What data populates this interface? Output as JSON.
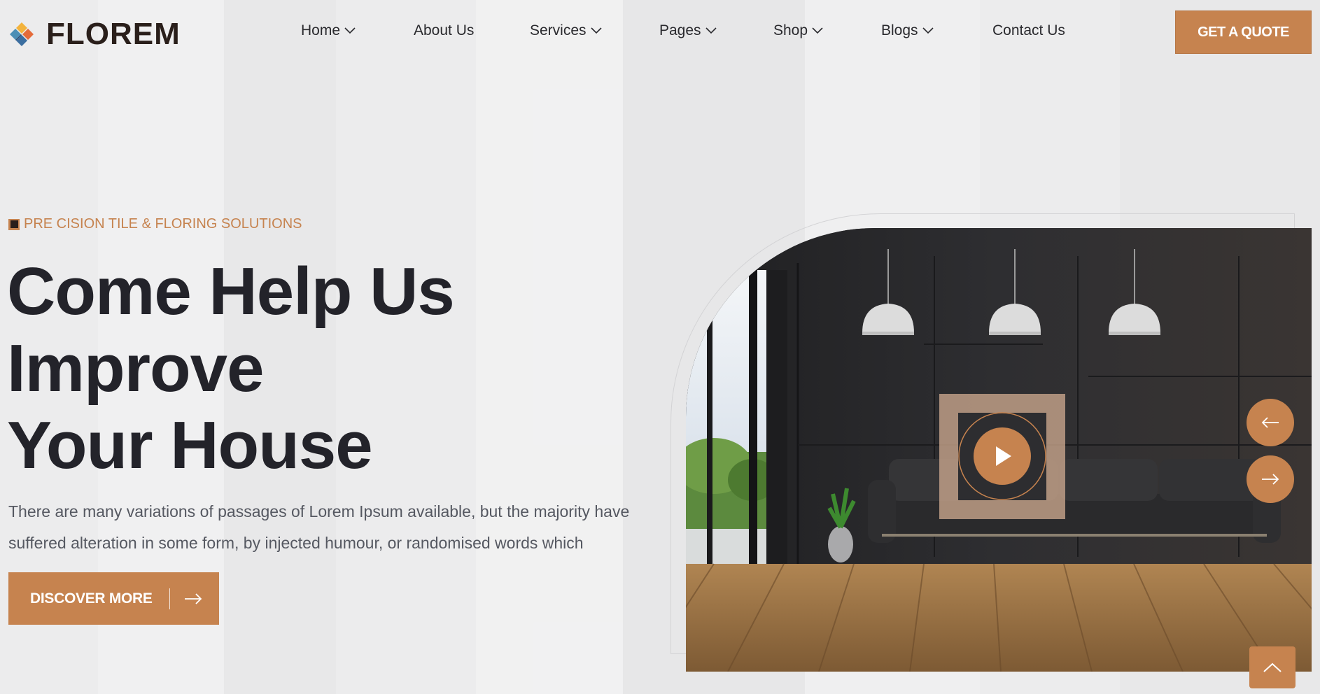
{
  "brand": {
    "name": "FLOREM",
    "accent": "#c6834f",
    "dark": "#23232a"
  },
  "nav": {
    "items": [
      {
        "label": "Home",
        "dropdown": true
      },
      {
        "label": "About Us",
        "dropdown": false
      },
      {
        "label": "Services",
        "dropdown": true
      },
      {
        "label": "Pages",
        "dropdown": true
      },
      {
        "label": "Shop",
        "dropdown": true
      },
      {
        "label": "Blogs",
        "dropdown": true
      },
      {
        "label": "Contact Us",
        "dropdown": false
      }
    ],
    "cta": "GET A QUOTE"
  },
  "hero": {
    "tagline": "PRE CISION TILE & FLORING SOLUTIONS",
    "title_lines": [
      "Come Help Us",
      "Improve",
      "Your House"
    ],
    "description_lines": [
      "There are many variations of passages of Lorem Ipsum available, but the majority have",
      "suffered alteration in some form, by injected humour, or randomised words which"
    ],
    "button": "DISCOVER MORE"
  },
  "icons": {
    "logo": "logo-mark-icon",
    "dropdown": "chevron-down-icon",
    "play": "play-icon",
    "prev": "arrow-left-icon",
    "next": "arrow-right-icon",
    "scroll_top": "chevron-up-icon"
  }
}
